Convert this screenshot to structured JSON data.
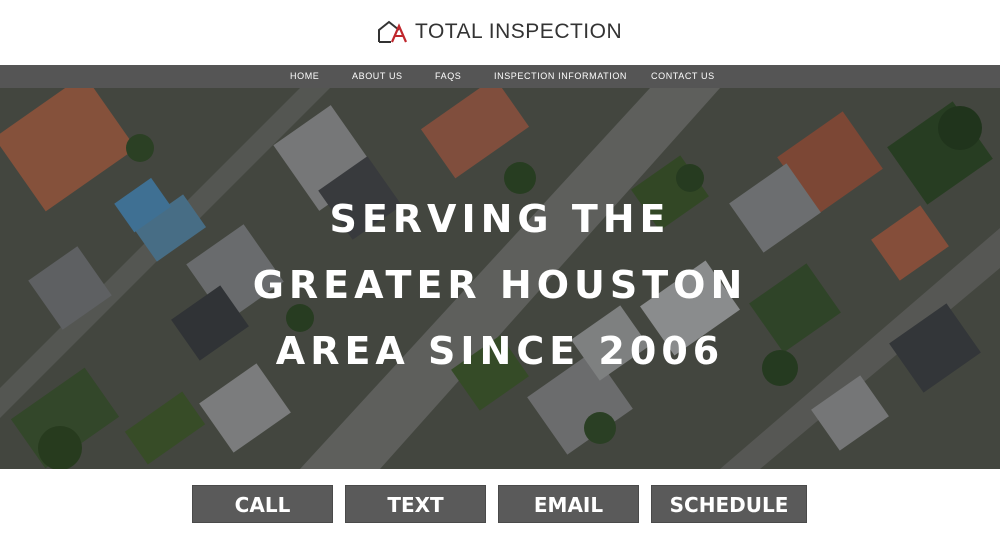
{
  "header": {
    "logo_text": "TOTAL INSPECTION",
    "logo_icon": "house-outline-icon",
    "logo_accent_color": "#c0272d"
  },
  "nav": {
    "items": [
      {
        "label": "HOME"
      },
      {
        "label": "ABOUT US"
      },
      {
        "label": "FAQS"
      },
      {
        "label": "INSPECTION INFORMATION"
      },
      {
        "label": "CONTACT US"
      }
    ]
  },
  "hero": {
    "heading_lines": [
      "SERVING THE",
      "GREATER HOUSTON",
      "AREA SINCE 2006"
    ]
  },
  "actions": {
    "call": "CALL",
    "text": "TEXT",
    "email": "EMAIL",
    "schedule": "SCHEDULE"
  },
  "colors": {
    "nav_background": "#555555",
    "button_background": "#5a5a5a"
  }
}
